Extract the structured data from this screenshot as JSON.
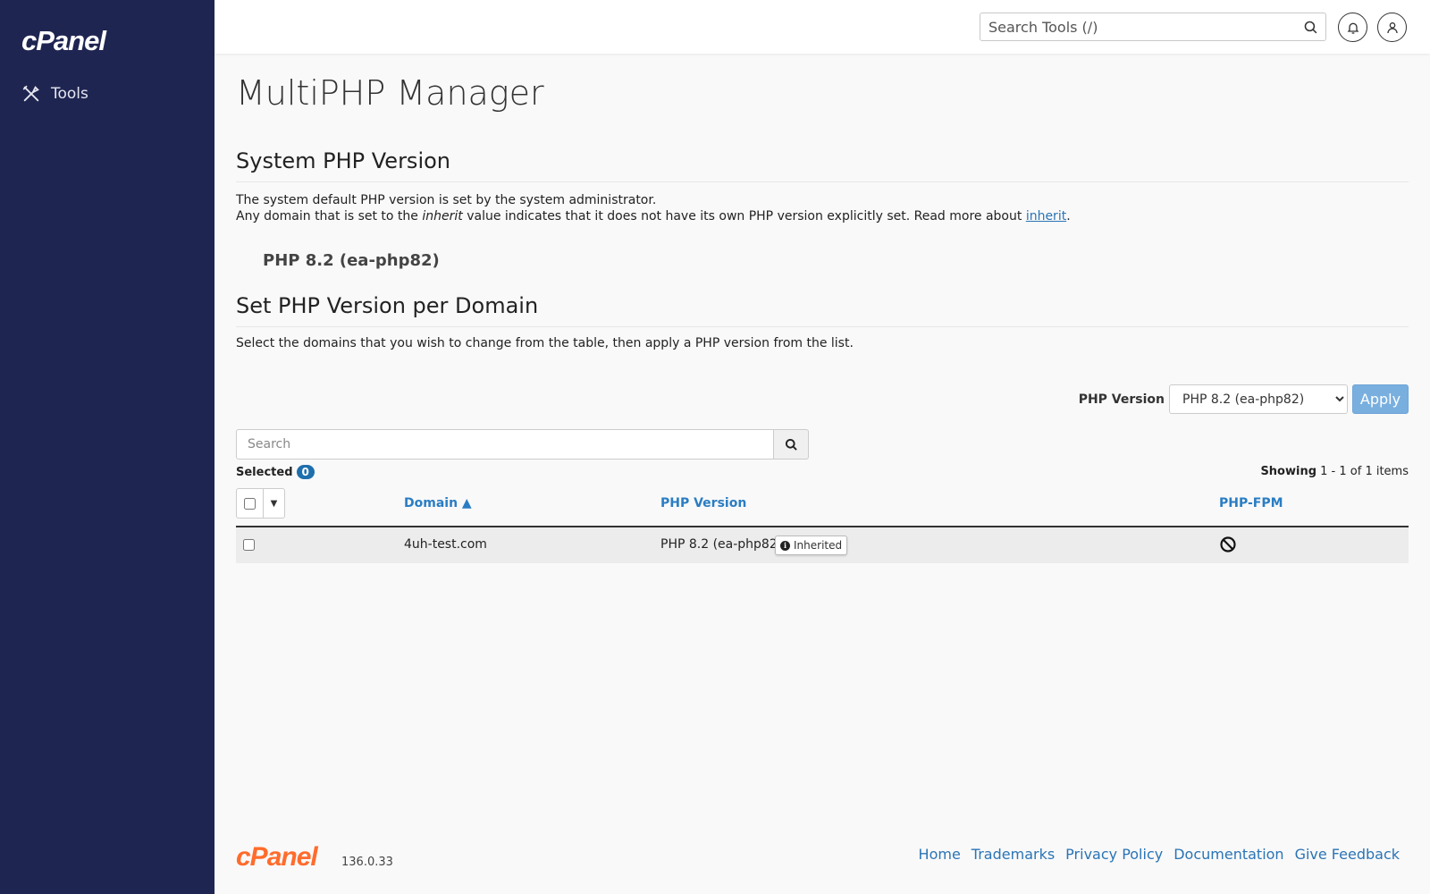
{
  "app": {
    "logo_text": "cPanel",
    "version": "136.0.33"
  },
  "sidebar": {
    "items": [
      {
        "label": "Tools",
        "icon": "tools-icon"
      }
    ]
  },
  "topbar": {
    "search_placeholder": "Search Tools (/)"
  },
  "page": {
    "title": "MultiPHP Manager"
  },
  "system_section": {
    "heading": "System PHP Version",
    "line1": "The system default PHP version is set by the system administrator.",
    "line2_before": "Any domain that is set to the ",
    "line2_italic": "inherit",
    "line2_after": " value indicates that it does not have its own PHP version explicitly set. Read more about ",
    "line2_link": "inherit",
    "line2_end": ".",
    "current_version": "PHP 8.2 (ea-php82)"
  },
  "domain_section": {
    "heading": "Set PHP Version per Domain",
    "description": "Select the domains that you wish to change from the table, then apply a PHP version from the list.",
    "php_version_label": "PHP Version",
    "php_version_selected": "PHP 8.2 (ea-php82)",
    "apply_label": "Apply",
    "search_placeholder": "Search",
    "selected_label": "Selected",
    "selected_count": "0",
    "showing_label": "Showing",
    "showing_range": "1 - 1 of 1 items"
  },
  "table": {
    "columns": {
      "domain": "Domain ▲",
      "php_version": "PHP Version",
      "php_fpm": "PHP-FPM"
    },
    "rows": [
      {
        "domain": "4uh-test.com",
        "php_version": "PHP 8.2 (ea-php82)",
        "badge": "Inherited",
        "php_fpm": "disabled-icon"
      }
    ]
  },
  "footer": {
    "links": [
      "Home",
      "Trademarks",
      "Privacy Policy",
      "Documentation",
      "Give Feedback"
    ]
  },
  "colors": {
    "sidebar_bg": "#1f2551",
    "link": "#2a74b5",
    "brand_orange": "#ff6c2c",
    "apply_bg": "#79afdf",
    "badge_bg": "#1f6fad"
  }
}
